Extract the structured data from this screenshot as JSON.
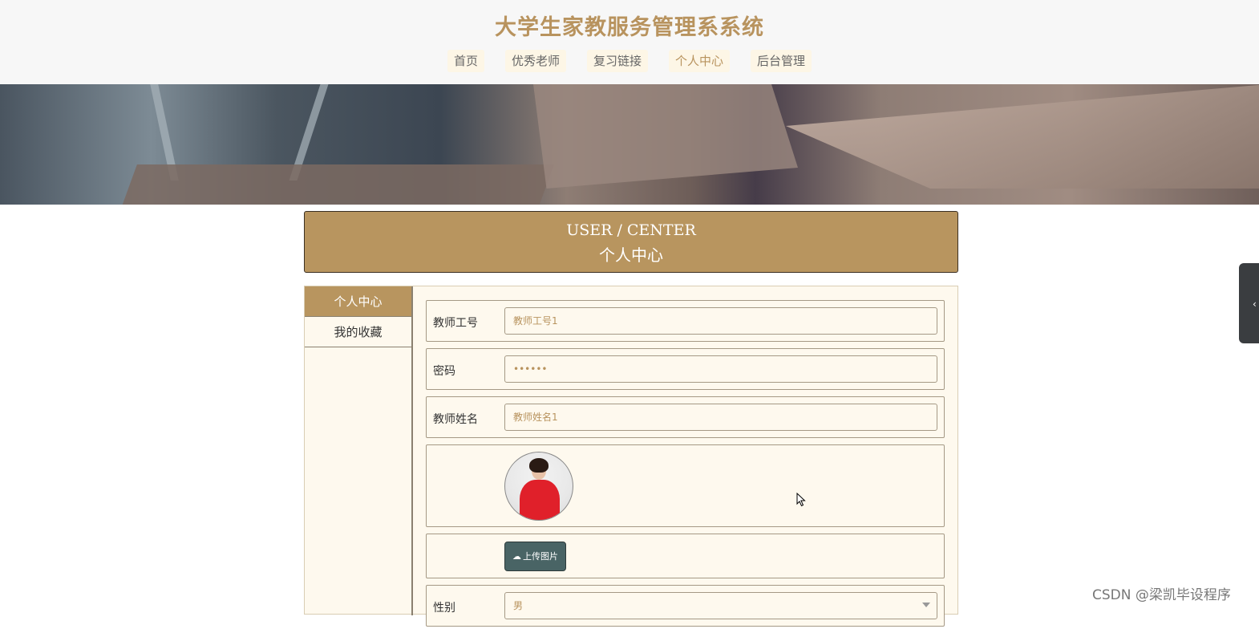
{
  "header": {
    "site_title": "大学生家教服务管理系系统",
    "nav": [
      "首页",
      "优秀老师",
      "复习链接",
      "个人中心",
      "后台管理"
    ]
  },
  "section": {
    "title_en": "USER / CENTER",
    "title_cn": "个人中心"
  },
  "sidebar": {
    "items": [
      "个人中心",
      "我的收藏"
    ]
  },
  "form": {
    "teacher_id": {
      "label": "教师工号",
      "value": "教师工号1"
    },
    "password": {
      "label": "密码",
      "value": "••••••"
    },
    "teacher_name": {
      "label": "教师姓名",
      "value": "教师姓名1"
    },
    "upload_label": "上传图片",
    "gender": {
      "label": "性别",
      "value": "男"
    }
  },
  "watermark": "CSDN @梁凯毕设程序",
  "colors": {
    "accent": "#b8955f",
    "title_text": "#b8935e",
    "panel_bg": "#fef9ee",
    "upload_button": "#496465"
  },
  "icons": {
    "upload": "cloud-upload-icon",
    "toggle": "chevron-left-icon",
    "select": "chevron-down-icon"
  }
}
